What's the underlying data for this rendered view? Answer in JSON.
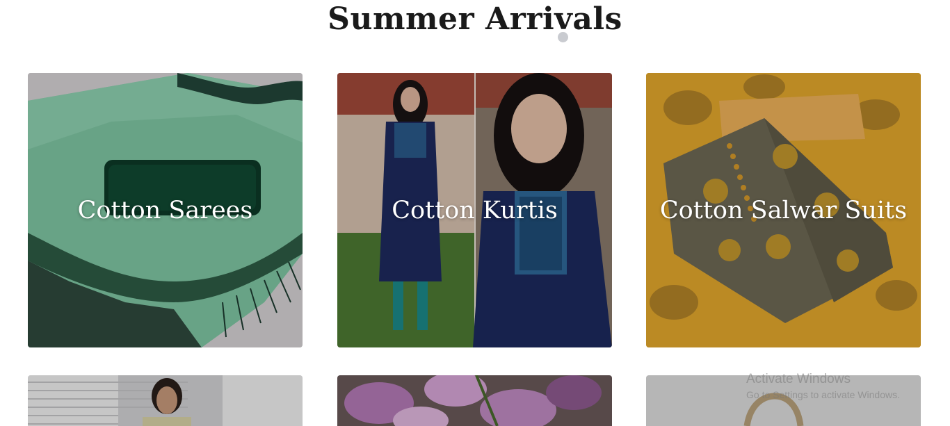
{
  "section": {
    "title": "Summer Arrivals"
  },
  "cards": [
    {
      "label": "Cotton Sarees"
    },
    {
      "label": "Cotton Kurtis"
    },
    {
      "label": "Cotton Salwar Suits"
    },
    {
      "label": ""
    },
    {
      "label": ""
    },
    {
      "label": ""
    }
  ],
  "watermark": {
    "title": "Activate Windows",
    "subtitle": "Go to Settings to activate Windows."
  },
  "colors": {
    "saree_green": "#7fc9a6",
    "kurti_navy": "#1f2a5a",
    "suit_yellow": "#e6ad2c",
    "suit_olive": "#6b6650"
  }
}
